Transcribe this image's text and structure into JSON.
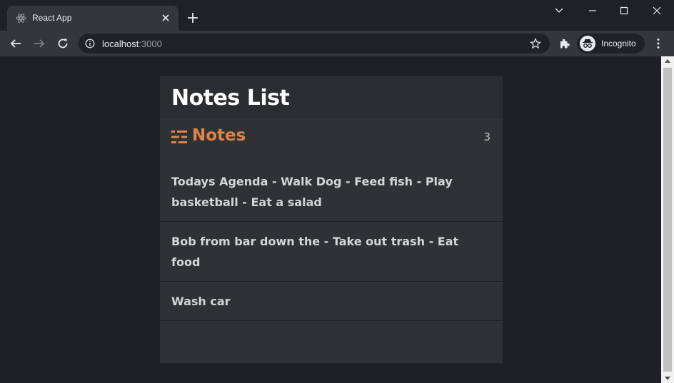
{
  "browser": {
    "tab_title": "React App",
    "url_host": "localhost",
    "url_port": ":3000",
    "profile_label": "Incognito"
  },
  "app": {
    "title": "Notes List",
    "notes_heading": "Notes",
    "notes_count": "3",
    "accent_color": "#e0824a",
    "notes": [
      "Todays Agenda - Walk Dog - Feed fish - Play basketball - Eat a salad",
      "Bob from bar down the - Take out trash - Eat food",
      "Wash car"
    ]
  }
}
